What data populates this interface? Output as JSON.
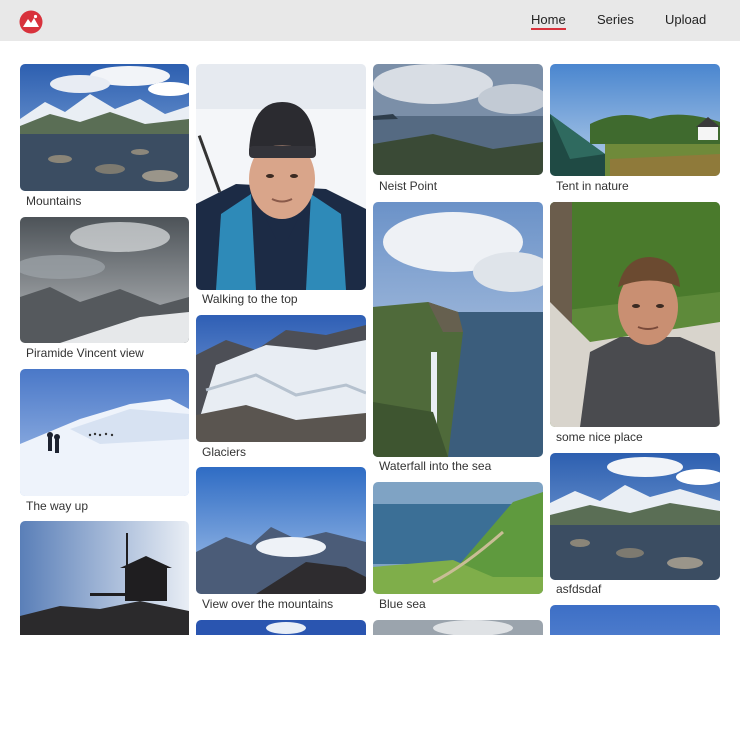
{
  "app": {
    "logo_icon": "mountain-logo-icon",
    "accent_color": "#d8323c"
  },
  "nav": {
    "home": "Home",
    "series": "Series",
    "upload": "Upload"
  },
  "gallery": {
    "photos": [
      {
        "caption": "Mountains",
        "scene": "mountain-lake"
      },
      {
        "caption": "Piramide Vincent view",
        "scene": "cloudy-peaks"
      },
      {
        "caption": "The way up",
        "scene": "snow-climbers"
      },
      {
        "caption": "",
        "scene": "hut-silhouette"
      },
      {
        "caption": "Walking to the top",
        "scene": "selfie-hat"
      },
      {
        "caption": "Glaciers",
        "scene": "glacier"
      },
      {
        "caption": "View over the mountains",
        "scene": "mountain-view"
      },
      {
        "caption": "",
        "scene": "blue-sky"
      },
      {
        "caption": "Neist Point",
        "scene": "coast-clouds"
      },
      {
        "caption": "Waterfall into the sea",
        "scene": "waterfall-cliff"
      },
      {
        "caption": "Blue sea",
        "scene": "blue-sea"
      },
      {
        "caption": "",
        "scene": "grey-sky"
      },
      {
        "caption": "Tent in nature",
        "scene": "tent"
      },
      {
        "caption": "some nice place",
        "scene": "selfie-hammock"
      },
      {
        "caption": "asfdsdaf",
        "scene": "mountain-lake-2"
      },
      {
        "caption": "",
        "scene": "blue-sky-2"
      }
    ]
  }
}
